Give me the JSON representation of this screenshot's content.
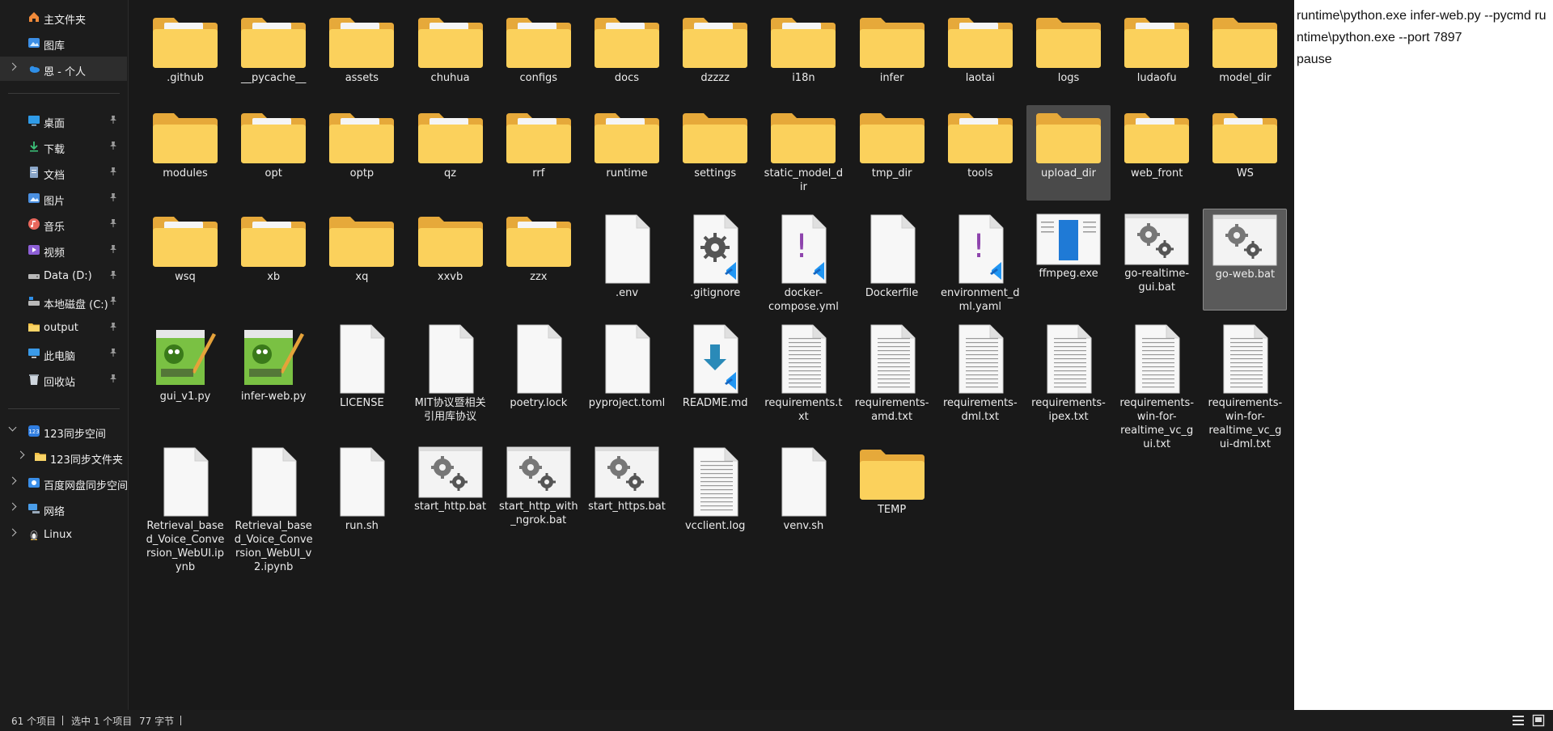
{
  "sidebar": {
    "top": [
      {
        "label": "主文件夹",
        "icon": "home-icon"
      },
      {
        "label": "图库",
        "icon": "gallery-icon"
      },
      {
        "label": "恩 - 个人",
        "icon": "onedrive-cloud-icon"
      }
    ],
    "quick": [
      {
        "label": "桌面",
        "icon": "desktop-icon"
      },
      {
        "label": "下载",
        "icon": "download-icon"
      },
      {
        "label": "文档",
        "icon": "documents-icon"
      },
      {
        "label": "图片",
        "icon": "pictures-icon"
      },
      {
        "label": "音乐",
        "icon": "music-icon"
      },
      {
        "label": "视频",
        "icon": "videos-icon"
      },
      {
        "label": "Data (D:)",
        "icon": "drive-icon"
      },
      {
        "label": "本地磁盘 (C:)",
        "icon": "system-drive-icon"
      },
      {
        "label": "output",
        "icon": "folder-icon"
      },
      {
        "label": "此电脑",
        "icon": "computer-icon"
      },
      {
        "label": "回收站",
        "icon": "recycle-bin-icon"
      }
    ],
    "tree": [
      {
        "label": "123同步空间",
        "icon": "sync-space-icon"
      },
      {
        "label": "123同步文件夹",
        "icon": "folder-icon"
      },
      {
        "label": "百度网盘同步空间",
        "icon": "baidu-netdisk-icon"
      },
      {
        "label": "网络",
        "icon": "network-icon"
      },
      {
        "label": "Linux",
        "icon": "linux-penguin-icon"
      }
    ]
  },
  "files": [
    {
      "name": ".github",
      "type": "folder-content"
    },
    {
      "name": "__pycache__",
      "type": "folder-content"
    },
    {
      "name": "assets",
      "type": "folder-content"
    },
    {
      "name": "chuhua",
      "type": "folder-content"
    },
    {
      "name": "configs",
      "type": "folder-content"
    },
    {
      "name": "docs",
      "type": "folder-content"
    },
    {
      "name": "dzzzz",
      "type": "folder-content"
    },
    {
      "name": "i18n",
      "type": "folder-content"
    },
    {
      "name": "infer",
      "type": "folder"
    },
    {
      "name": "laotai",
      "type": "folder-content"
    },
    {
      "name": "logs",
      "type": "folder"
    },
    {
      "name": "ludaofu",
      "type": "folder-content"
    },
    {
      "name": "model_dir",
      "type": "folder"
    },
    {
      "name": "modules",
      "type": "folder"
    },
    {
      "name": "opt",
      "type": "folder-content"
    },
    {
      "name": "optp",
      "type": "folder-content"
    },
    {
      "name": "qz",
      "type": "folder-content"
    },
    {
      "name": "rrf",
      "type": "folder-content"
    },
    {
      "name": "runtime",
      "type": "folder-content"
    },
    {
      "name": "settings",
      "type": "folder"
    },
    {
      "name": "static_model_dir",
      "type": "folder"
    },
    {
      "name": "tmp_dir",
      "type": "folder"
    },
    {
      "name": "tools",
      "type": "folder-content"
    },
    {
      "name": "upload_dir",
      "type": "folder",
      "selected": "hover"
    },
    {
      "name": "web_front",
      "type": "folder-content"
    },
    {
      "name": "WS",
      "type": "folder-content"
    },
    {
      "name": "wsq",
      "type": "folder-content"
    },
    {
      "name": "xb",
      "type": "folder-content"
    },
    {
      "name": "xq",
      "type": "folder"
    },
    {
      "name": "xxvb",
      "type": "folder"
    },
    {
      "name": "zzx",
      "type": "folder-content"
    },
    {
      "name": ".env",
      "type": "doc"
    },
    {
      "name": ".gitignore",
      "type": "vscode-gear"
    },
    {
      "name": "docker-compose.yml",
      "type": "vscode-yaml"
    },
    {
      "name": "Dockerfile",
      "type": "doc"
    },
    {
      "name": "environment_dml.yaml",
      "type": "vscode-yaml"
    },
    {
      "name": "ffmpeg.exe",
      "type": "exe"
    },
    {
      "name": "go-realtime-gui.bat",
      "type": "bat"
    },
    {
      "name": "go-web.bat",
      "type": "bat",
      "selected": "selected"
    },
    {
      "name": "gui_v1.py",
      "type": "notepad"
    },
    {
      "name": "infer-web.py",
      "type": "notepad"
    },
    {
      "name": "LICENSE",
      "type": "doc"
    },
    {
      "name": "MIT协议暨相关引用库协议",
      "type": "doc"
    },
    {
      "name": "poetry.lock",
      "type": "doc"
    },
    {
      "name": "pyproject.toml",
      "type": "doc"
    },
    {
      "name": "README.md",
      "type": "vscode-md"
    },
    {
      "name": "requirements.txt",
      "type": "txt"
    },
    {
      "name": "requirements-amd.txt",
      "type": "txt"
    },
    {
      "name": "requirements-dml.txt",
      "type": "txt"
    },
    {
      "name": "requirements-ipex.txt",
      "type": "txt"
    },
    {
      "name": "requirements-win-for-realtime_vc_gui.txt",
      "type": "txt"
    },
    {
      "name": "requirements-win-for-realtime_vc_gui-dml.txt",
      "type": "txt"
    },
    {
      "name": "Retrieval_based_Voice_Conversion_WebUI.ipynb",
      "type": "doc"
    },
    {
      "name": "Retrieval_based_Voice_Conversion_WebUI_v2.ipynb",
      "type": "doc"
    },
    {
      "name": "run.sh",
      "type": "doc"
    },
    {
      "name": "start_http.bat",
      "type": "bat"
    },
    {
      "name": "start_http_with_ngrok.bat",
      "type": "bat"
    },
    {
      "name": "start_https.bat",
      "type": "bat"
    },
    {
      "name": "vcclient.log",
      "type": "txt"
    },
    {
      "name": "venv.sh",
      "type": "doc"
    },
    {
      "name": "TEMP",
      "type": "folder"
    }
  ],
  "preview": {
    "text": "runtime\\python.exe infer-web.py --pycmd runtime\\python.exe --port 7897\npause"
  },
  "status": {
    "count": "61 个项目",
    "selected": "选中 1 个项目",
    "size": "77 字节"
  },
  "colors": {
    "folder": "#f6c344",
    "folder_back": "#e6a93a",
    "accent": "#1f7ad6",
    "vscode_blue": "#2196f3"
  }
}
